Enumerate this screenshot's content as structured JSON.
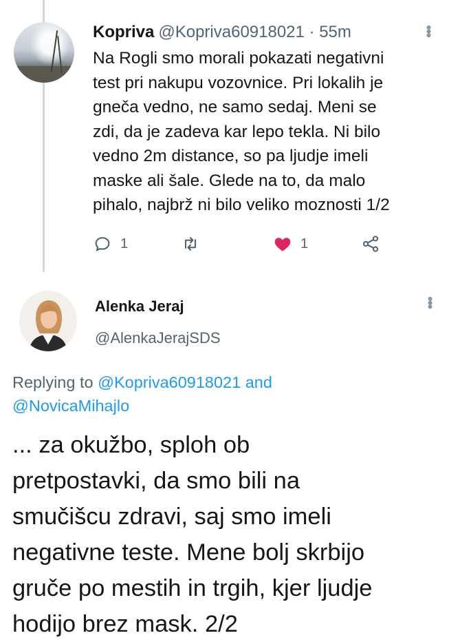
{
  "tweet1": {
    "display_name": "Kopriva",
    "handle_time": "@Kopriva60918021 · 55m",
    "lines": [
      "Na Rogli smo morali pokazati negativni",
      "test pri nakupu vozovnice. Pri lokalih je",
      "gneča vedno, ne samo sedaj. Meni se",
      "zdi, da je zadeva kar lepo tekla. Ni bilo",
      "vedno 2m distance, so pa ljudje imeli",
      "maske ali šale. Glede na to, da malo",
      "pihalo, najbrž ni bilo veliko moznosti 1/2"
    ],
    "reply_count": "1",
    "like_count": "1",
    "like_color": "#e0245e"
  },
  "tweet2": {
    "display_name": "Alenka Jeraj",
    "handle": "@AlenkaJerajSDS",
    "replying_prefix": "Replying to ",
    "replying_mention1": "@Kopriva60918021",
    "replying_and": " and",
    "replying_mention2": "@NovicaMihajlo",
    "lines": [
      "... za okužbo, sploh ob",
      "pretpostavki, da smo bili na",
      "smučišcu zdravi, saj smo imeli",
      "negativne teste. Mene bolj skrbijo",
      "gruče po mestih in trgih, kjer ljudje",
      "hodijo brez mask. 2/2"
    ]
  },
  "icons": [
    "reply-icon",
    "retweet-icon",
    "like-icon",
    "share-icon",
    "more-icon"
  ],
  "accent": "#1d9bf0"
}
